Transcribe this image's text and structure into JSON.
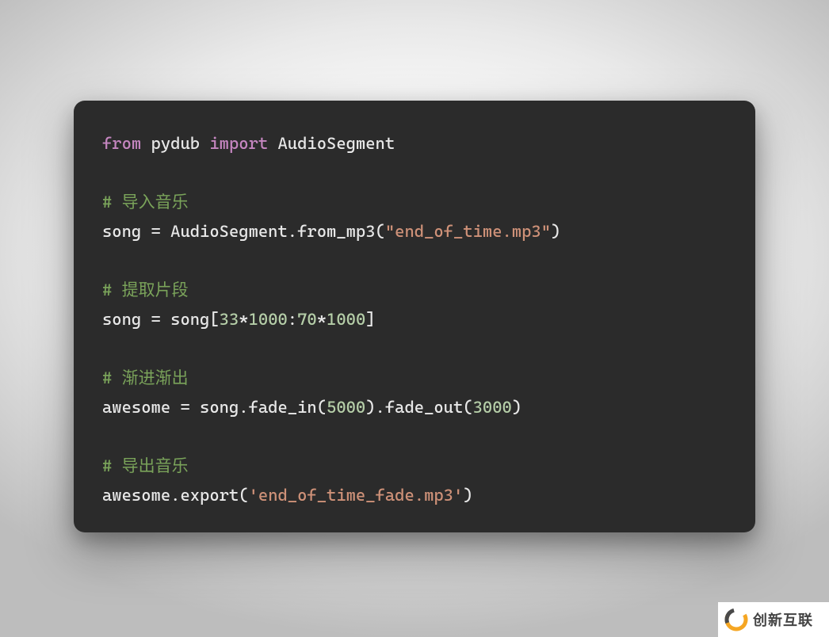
{
  "code": {
    "l1_from": "from",
    "l1_pydub": " pydub ",
    "l1_import": "import",
    "l1_audioseg": " AudioSegment",
    "c1": "# 导入音乐",
    "l2_a": "song = AudioSegment.from_mp3(",
    "l2_str": "\"end_of_time.mp3\"",
    "l2_b": ")",
    "c2": "# 提取片段",
    "l3_a": "song = song[",
    "l3_n1": "33",
    "l3_op1": "*",
    "l3_n2": "1000",
    "l3_colon": ":",
    "l3_n3": "70",
    "l3_op2": "*",
    "l3_n4": "1000",
    "l3_b": "]",
    "c3": "# 渐进渐出",
    "l4_a": "awesome = song.fade_in(",
    "l4_n1": "5000",
    "l4_b": ").fade_out(",
    "l4_n2": "3000",
    "l4_c": ")",
    "c4": "# 导出音乐",
    "l5_a": "awesome.export(",
    "l5_str": "'end_of_time_fade.mp3'",
    "l5_b": ")"
  },
  "watermark": {
    "text": "创新互联"
  }
}
